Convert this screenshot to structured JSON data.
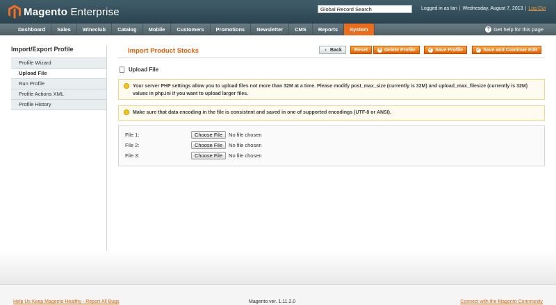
{
  "header": {
    "logo_brand": "Magento",
    "logo_edition": "Enterprise",
    "search_value": "Global Record Search",
    "logged_in": "Logged in as Ian",
    "date": "Wednesday, August 7, 2013",
    "logout": "Log Out"
  },
  "nav": {
    "items": [
      "Dashboard",
      "Sales",
      "Wineclub",
      "Catalog",
      "Mobile",
      "Customers",
      "Promotions",
      "Newsletter",
      "CMS",
      "Reports",
      "System"
    ],
    "active": "System",
    "help": "Get help for this page"
  },
  "sidebar": {
    "title": "Import/Export Profile",
    "items": [
      "Profile Wizard",
      "Upload File",
      "Run Profile",
      "Profile Actions XML",
      "Profile History"
    ],
    "active": "Upload File"
  },
  "main": {
    "title": "Import Product Stocks",
    "buttons": {
      "back": "Back",
      "reset": "Reset",
      "delete": "Delete Profile",
      "save": "Save Profile",
      "save_continue": "Save and Continue Edit"
    },
    "section_title": "Upload File",
    "notice1": "Your server PHP settings allow you to upload files not more than 32M at a time. Please modify post_max_size (currently is 32M) and upload_max_filesize (currently is 32M) values in php.ini if you want to upload larger files.",
    "notice2": "Make sure that data encoding in the file is consistent and saved in one of supported encodings (UTF-8 or ANSI).",
    "files": [
      {
        "label": "File 1:",
        "button": "Choose File",
        "status": "No file chosen"
      },
      {
        "label": "File 2:",
        "button": "Choose File",
        "status": "No file chosen"
      },
      {
        "label": "File 3:",
        "button": "Choose File",
        "status": "No file chosen"
      }
    ]
  },
  "footer": {
    "left": "Help Us Keep Magento Healthy - Report All Bugs",
    "version": "Magento ver. 1.11.2.0",
    "right": "Connect with the Magento Community"
  },
  "colors": {
    "accent": "#eb5e00",
    "nav_active": "#eb6d1c",
    "header_bg": "#2c4550"
  }
}
